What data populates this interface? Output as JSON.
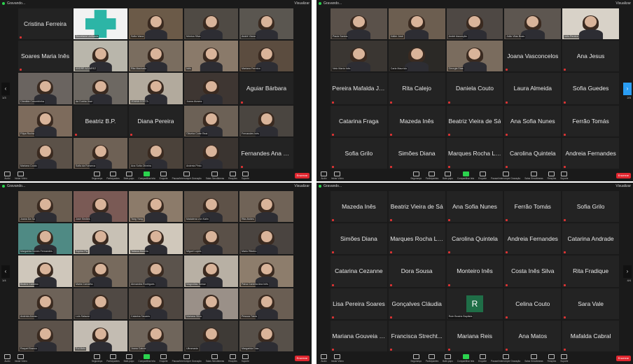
{
  "window": {
    "title": "Gravando...",
    "view_label": "Visualizar"
  },
  "toolbar": {
    "left": [
      {
        "label": "Áudio"
      },
      {
        "label": "Iniciar Vídeo"
      }
    ],
    "center": [
      {
        "label": "Segurança"
      },
      {
        "label": "Participantes"
      },
      {
        "label": "Bate-papo"
      },
      {
        "label": "Compartilhar tela",
        "share": true
      },
      {
        "label": "Enquete"
      },
      {
        "label": "Pausar/Interromper Gravação"
      },
      {
        "label": "Salas Simultâneas"
      },
      {
        "label": "Reações"
      },
      {
        "label": "Suporte"
      }
    ],
    "end_label": "Encerrar"
  },
  "panels": [
    {
      "arrow_left": "1/3",
      "arrow_right": null,
      "tiles": [
        {
          "type": "name",
          "name": "Cristina Ferreira"
        },
        {
          "type": "logo",
          "label": "Secretaria Unificada"
        },
        {
          "type": "video",
          "label": "Sofia Viana",
          "c": "#6b5a48"
        },
        {
          "type": "video",
          "label": "Mónica Silva",
          "c": "#4f4a44"
        },
        {
          "type": "video",
          "label": "André Viana",
          "c": "#5a5650"
        },
        {
          "type": "name",
          "name": "Soares Maria Inês"
        },
        {
          "type": "video",
          "label": "ANDRÉ ALVAREZ",
          "c": "#b9b6ab"
        },
        {
          "type": "video",
          "label": "Rita Machado",
          "c": "#7a6d5f"
        },
        {
          "type": "video",
          "label": "Inês",
          "c": "#8a7a6a"
        },
        {
          "type": "video",
          "label": "Mariana Ferreira",
          "c": "#5b4c3f"
        },
        {
          "type": "video",
          "label": "Cândida Corumbinha",
          "c": "#6a6460"
        },
        {
          "type": "video",
          "label": "da Cunha José",
          "c": "#6d6862"
        },
        {
          "type": "video",
          "label": "JOANA COSTA",
          "c": "#b2aa9d"
        },
        {
          "type": "video",
          "label": "Joana Alvarez",
          "c": "#3e3632"
        },
        {
          "type": "name",
          "name": "Aguiar Bárbara"
        },
        {
          "type": "video",
          "label": "Filipa Rocha",
          "c": "#7d6b5c"
        },
        {
          "type": "name",
          "name": "Beatriz B.P."
        },
        {
          "type": "name",
          "name": "Diana Pereira"
        },
        {
          "type": "video",
          "label": "Oliveira Corte Real",
          "c": "#6c6156"
        },
        {
          "type": "video",
          "label": "Fernandes Inês",
          "c": "#4a4540"
        },
        {
          "type": "video",
          "label": "Mariana Couto",
          "c": "#5b5148"
        },
        {
          "type": "video",
          "label": "Sofia da Fonseca",
          "c": "#6e6155"
        },
        {
          "type": "video",
          "label": "Ana Sofia Oliveira",
          "c": "#4b423a"
        },
        {
          "type": "video",
          "label": "Andreia Pinto",
          "c": "#3a3430"
        },
        {
          "type": "name",
          "name": "Fernandes Ana João"
        }
      ]
    },
    {
      "arrow_left": null,
      "arrow_right": "2/3",
      "tiles": [
        {
          "type": "video",
          "label": "Paula Santos",
          "c": "#5a514a"
        },
        {
          "type": "video",
          "label": "Válter José",
          "c": "#6c5e50"
        },
        {
          "type": "video",
          "label": "André Assunção",
          "c": "#4e4844"
        },
        {
          "type": "video",
          "label": "João Vilas Boas",
          "c": "#5d5650"
        },
        {
          "type": "video",
          "label": "Inês Pereira",
          "c": "#d8d2c8"
        },
        {
          "type": "video",
          "label": "Nelo Marta Inês",
          "c": "#3a3632"
        },
        {
          "type": "video",
          "label": "Carla Maurício",
          "c": "#2b2926"
        },
        {
          "type": "video",
          "label": "Georgia Dias",
          "c": "#7a6c5e"
        },
        {
          "type": "name",
          "name": "Joana Vasconcelos"
        },
        {
          "type": "name",
          "name": "Ana Jesus"
        },
        {
          "type": "name",
          "name": "Pereira Mafalda Jo..."
        },
        {
          "type": "name",
          "name": "Rita Calejo"
        },
        {
          "type": "name",
          "name": "Daniela Couto"
        },
        {
          "type": "name",
          "name": "Laura Almeida"
        },
        {
          "type": "name",
          "name": "Sofia Guedes"
        },
        {
          "type": "name",
          "name": "Catarina Fraga"
        },
        {
          "type": "name",
          "name": "Mazeda Inês"
        },
        {
          "type": "name",
          "name": "Beatriz Vieira de Sá"
        },
        {
          "type": "name",
          "name": "Ana Sofia Nunes"
        },
        {
          "type": "name",
          "name": "Ferrão Tomás"
        },
        {
          "type": "name",
          "name": "Sofia Grilo"
        },
        {
          "type": "name",
          "name": "Simões Diana"
        },
        {
          "type": "name",
          "name": "Marques Rocha Lú..."
        },
        {
          "type": "name",
          "name": "Carolina Quintela"
        },
        {
          "type": "name",
          "name": "Andreia Fernandes"
        }
      ]
    },
    {
      "arrow_left": "1/4",
      "arrow_right": null,
      "tiles": [
        {
          "type": "video",
          "label": "Joana Da Sá",
          "c": "#6a5d50"
        },
        {
          "type": "video",
          "label": "José Simões",
          "c": "#7a5a55"
        },
        {
          "type": "video",
          "label": "Tang Yang",
          "c": "#8c7b6a"
        },
        {
          "type": "video",
          "label": "Madalena von Kalm",
          "c": "#5e5248"
        },
        {
          "type": "video",
          "label": "Rita Alvites",
          "c": "#706357"
        },
        {
          "type": "video",
          "label": "Margarida Nunes Fernandes",
          "c": "#4f8a84"
        },
        {
          "type": "video",
          "label": "Sophia Pia",
          "c": "#c8c1b5"
        },
        {
          "type": "video",
          "label": "Tatiana Moreira",
          "c": "#d0c8bb"
        },
        {
          "type": "video",
          "label": "Miguel Lopes",
          "c": "#5a5048"
        },
        {
          "type": "video",
          "label": "Mario Ribeiro",
          "c": "#4a4440"
        },
        {
          "type": "video",
          "label": "Beatriz Cardoso",
          "c": "#cfc7bb"
        },
        {
          "type": "video",
          "label": "Marta Carvalho",
          "c": "#776a5d"
        },
        {
          "type": "video",
          "label": "Alexandra Rodrigues",
          "c": "#5b534c"
        },
        {
          "type": "video",
          "label": "Magnólias Tomaz",
          "c": "#b8b0a4"
        },
        {
          "type": "video",
          "label": "Paiva Carreira Ana Inês",
          "c": "#8d7d6c"
        },
        {
          "type": "video",
          "label": "Andreia Afonso",
          "c": "#6d6258"
        },
        {
          "type": "video",
          "label": "Luís Salazar",
          "c": "#504944"
        },
        {
          "type": "video",
          "label": "Catarina Tavares",
          "c": "#4e4640"
        },
        {
          "type": "video",
          "label": "Mariana Silva",
          "c": "#9a9088"
        },
        {
          "type": "video",
          "label": "Pessoa Tânia",
          "c": "#6a5e53"
        },
        {
          "type": "video",
          "label": "Raquel Branco",
          "c": "#5c524a"
        },
        {
          "type": "video",
          "label": "Rui Melo",
          "c": "#c3bcb2"
        },
        {
          "type": "video",
          "label": "Joana Cabral",
          "c": "#6f655b"
        },
        {
          "type": "video",
          "label": "Ultramaria",
          "c": "#3e3a36"
        },
        {
          "type": "video",
          "label": "Margarida Dias",
          "c": "#575049"
        }
      ]
    },
    {
      "arrow_left": null,
      "arrow_right": "4/4",
      "tiles": [
        {
          "type": "name",
          "name": "Mazeda Inês"
        },
        {
          "type": "name",
          "name": "Beatriz Vieira de Sá"
        },
        {
          "type": "name",
          "name": "Ana Sofia Nunes"
        },
        {
          "type": "name",
          "name": "Ferrão Tomás"
        },
        {
          "type": "name",
          "name": "Sofia Grilo"
        },
        {
          "type": "name",
          "name": "Simões Diana"
        },
        {
          "type": "name",
          "name": "Marques Rocha Lú..."
        },
        {
          "type": "name",
          "name": "Carolina Quintela"
        },
        {
          "type": "name",
          "name": "Andreia Fernandes"
        },
        {
          "type": "name",
          "name": "Catarina Andrade"
        },
        {
          "type": "name",
          "name": "Catarina Cezanne"
        },
        {
          "type": "name",
          "name": "Dora Sousa"
        },
        {
          "type": "name",
          "name": "Monteiro Inês"
        },
        {
          "type": "name",
          "name": "Costa Inês Silva"
        },
        {
          "type": "name",
          "name": "Rita Fradique"
        },
        {
          "type": "name",
          "name": "Lisa Pereira Soares"
        },
        {
          "type": "name",
          "name": "Gonçalves Cláudia"
        },
        {
          "type": "letter",
          "name": "R",
          "label": "Rute Beatriz Baptista"
        },
        {
          "type": "name",
          "name": "Celina Couto"
        },
        {
          "type": "name",
          "name": "Sara Vale"
        },
        {
          "type": "name",
          "name": "Mariana Gouveia L..."
        },
        {
          "type": "name",
          "name": "Francisca Strecht..."
        },
        {
          "type": "name",
          "name": "Mariana Reis"
        },
        {
          "type": "name",
          "name": "Ana Matos"
        },
        {
          "type": "name",
          "name": "Mafalda Cabral"
        }
      ]
    }
  ]
}
